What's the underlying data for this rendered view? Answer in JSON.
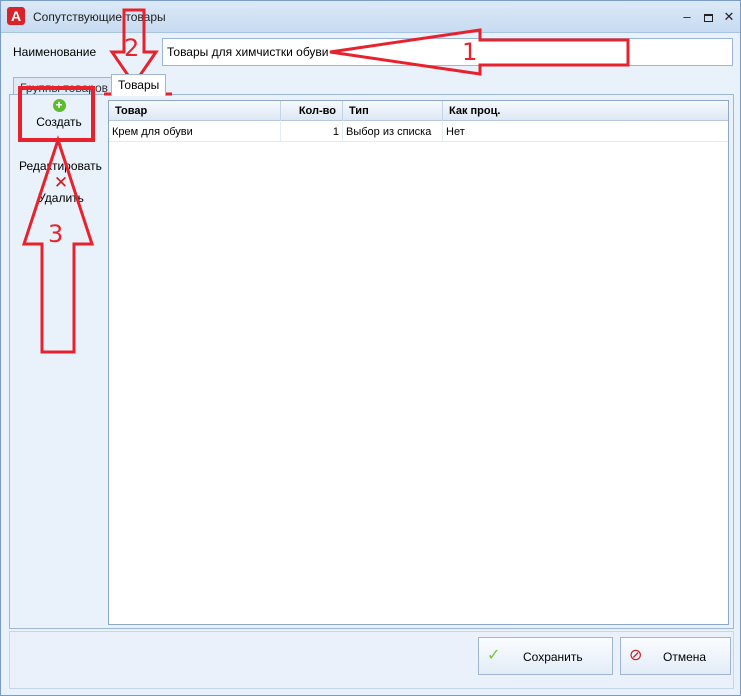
{
  "window": {
    "title": "Сопутствующие товары",
    "minimize": "–",
    "maximize": "",
    "close": "✕"
  },
  "form": {
    "name_label": "Наименование",
    "name_value": "Товары для химчистки обуви"
  },
  "tabs": [
    {
      "label": "Группы товаров"
    },
    {
      "label": "Товары"
    }
  ],
  "sidebar": {
    "create": "Создать",
    "edit": "Редактировать",
    "delete": "Удалить"
  },
  "grid": {
    "columns": [
      "Товар",
      "Кол-во",
      "Тип",
      "Как проц."
    ],
    "rows": [
      {
        "product": "Крем для обуви",
        "qty": "1",
        "type": "Выбор из списка",
        "as_percent": "Нет"
      }
    ]
  },
  "footer": {
    "save": "Сохранить",
    "cancel": "Отмена"
  },
  "annotations": {
    "n1": "1",
    "n2": "2",
    "n3": "3",
    "color": "#e8222d"
  },
  "colors": {
    "accent_red": "#d8232a",
    "ok_green": "#7bc142"
  }
}
